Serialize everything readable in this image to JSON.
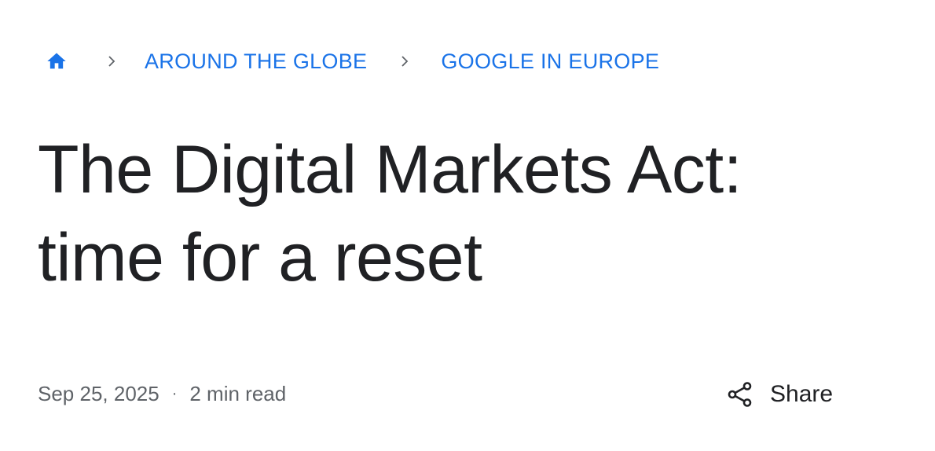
{
  "breadcrumb": {
    "home_icon": "home-icon",
    "separator_icon": "chevron-right-icon",
    "items": [
      {
        "label": "AROUND THE GLOBE"
      },
      {
        "label": "GOOGLE IN EUROPE"
      }
    ]
  },
  "article": {
    "title_line1": "The Digital Markets Act:",
    "title_line2": "time for a reset",
    "date": "Sep 25, 2025",
    "separator": "·",
    "read_time": "2 min read"
  },
  "share": {
    "icon": "share-icon",
    "label": "Share"
  },
  "colors": {
    "accent": "#1a73e8",
    "text": "#202124",
    "muted": "#5f6368"
  }
}
